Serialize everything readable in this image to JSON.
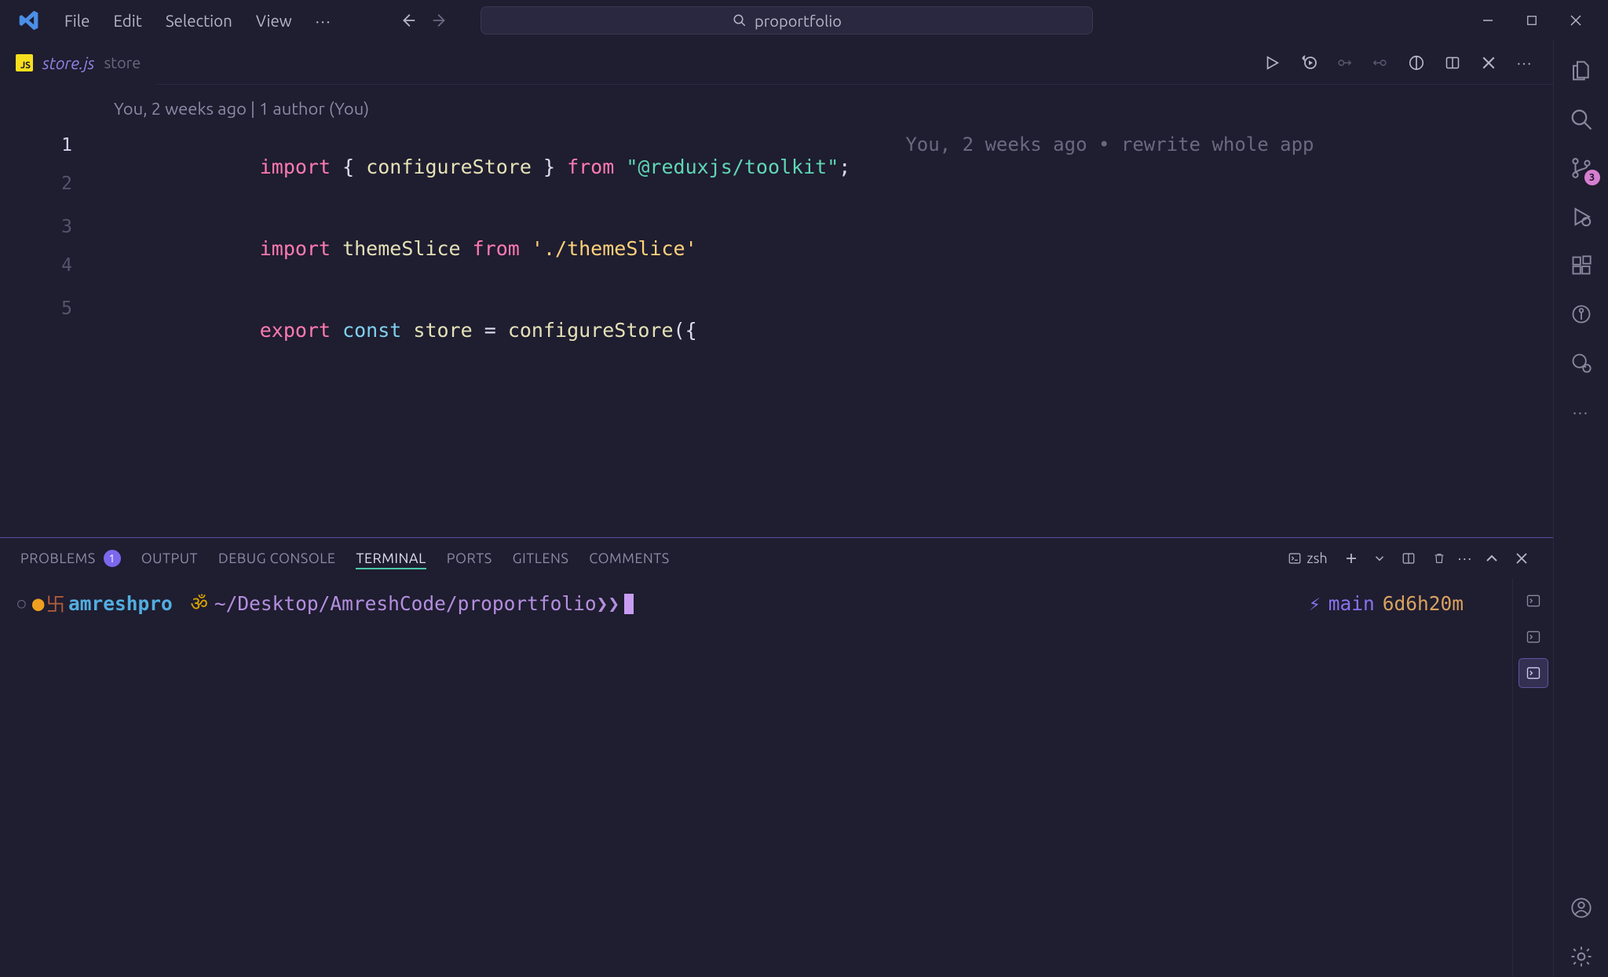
{
  "menu": {
    "items": [
      "File",
      "Edit",
      "Selection",
      "View"
    ]
  },
  "command_center": {
    "text": "proportfolio"
  },
  "tab": {
    "file_name": "store.js",
    "dir": "store"
  },
  "blame_header": "You, 2 weeks ago | 1 author (You)",
  "code": {
    "l1": {
      "import": "import",
      "brace_open": " { ",
      "ident": "configureStore",
      "brace_close": " } ",
      "from": "from ",
      "str": "\"@reduxjs/toolkit\"",
      "semi": ";"
    },
    "l3": {
      "import": "import",
      "ident": " themeSlice ",
      "from": "from ",
      "str": "'./themeSlice'"
    },
    "l5": {
      "export": "export ",
      "const": "const ",
      "ident": "store ",
      "eq": "= ",
      "fn": "configureStore",
      "tail": "({"
    }
  },
  "line_nums": [
    "1",
    "2",
    "3",
    "4",
    "5"
  ],
  "blame_inline": "You, 2 weeks ago • rewrite whole app",
  "panel_tabs": {
    "problems": "PROBLEMS",
    "problems_badge": "1",
    "output": "OUTPUT",
    "debug": "DEBUG CONSOLE",
    "terminal": "TERMINAL",
    "ports": "PORTS",
    "gitlens": "GITLENS",
    "comments": "COMMENTS"
  },
  "terminal_selector": "zsh",
  "terminal": {
    "user": "amreshpro",
    "path": "~/Desktop/AmreshCode/proportfolio",
    "prompt": "❯❯",
    "branch": "main",
    "age": "6d6h20m"
  },
  "scm_badge": "3"
}
